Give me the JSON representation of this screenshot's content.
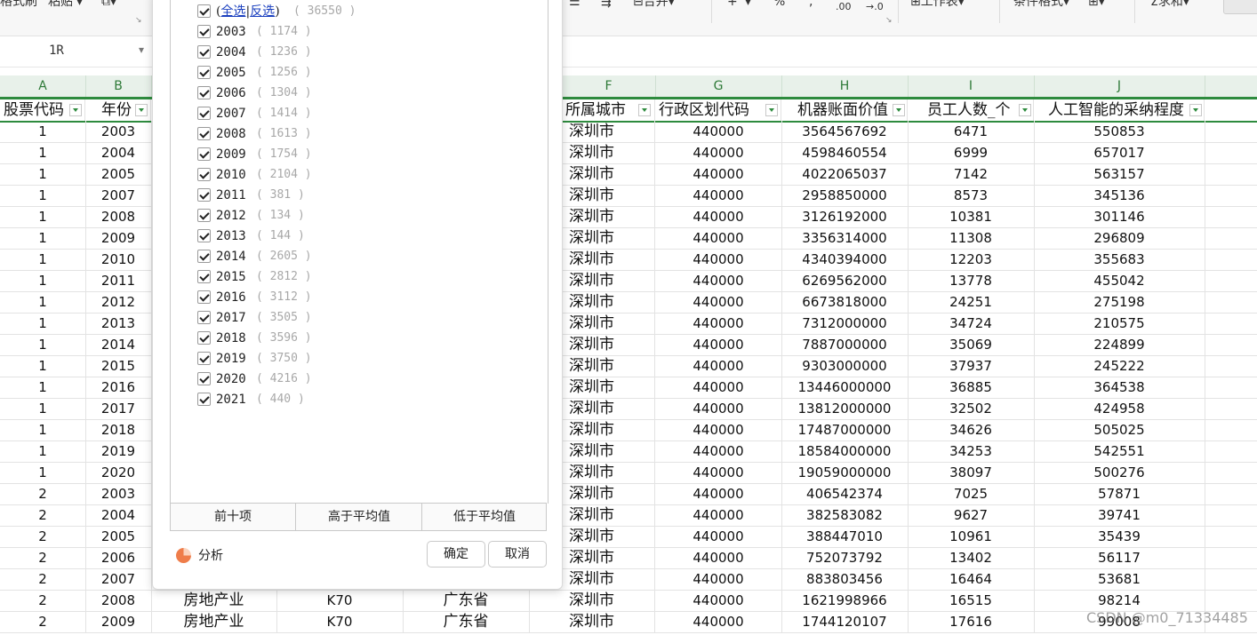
{
  "toolbar": {
    "items": [
      "格式刷",
      "粘贴",
      "合并",
      "工作表",
      "条件格式",
      "求和"
    ],
    "symbols": [
      "%",
      ",",
      ".00",
      "→.0",
      "+"
    ]
  },
  "formula_bar": {
    "name_box": "1R"
  },
  "columns": [
    "A",
    "B",
    "F",
    "G",
    "H",
    "I",
    "J"
  ],
  "headers": {
    "A": "股票代码",
    "B": "年份",
    "F": "所属城市",
    "G": "行政区划代码",
    "H": "机器账面价值",
    "I": "员工人数_个",
    "J": "人工智能的采纳程度"
  },
  "rows": [
    {
      "a": "1",
      "b": "2003",
      "f": "深圳市",
      "g": "440000",
      "h": "3564567692",
      "i": "6471",
      "j": "550853"
    },
    {
      "a": "1",
      "b": "2004",
      "f": "深圳市",
      "g": "440000",
      "h": "4598460554",
      "i": "6999",
      "j": "657017"
    },
    {
      "a": "1",
      "b": "2005",
      "f": "深圳市",
      "g": "440000",
      "h": "4022065037",
      "i": "7142",
      "j": "563157"
    },
    {
      "a": "1",
      "b": "2007",
      "f": "深圳市",
      "g": "440000",
      "h": "2958850000",
      "i": "8573",
      "j": "345136"
    },
    {
      "a": "1",
      "b": "2008",
      "f": "深圳市",
      "g": "440000",
      "h": "3126192000",
      "i": "10381",
      "j": "301146"
    },
    {
      "a": "1",
      "b": "2009",
      "f": "深圳市",
      "g": "440000",
      "h": "3356314000",
      "i": "11308",
      "j": "296809"
    },
    {
      "a": "1",
      "b": "2010",
      "f": "深圳市",
      "g": "440000",
      "h": "4340394000",
      "i": "12203",
      "j": "355683"
    },
    {
      "a": "1",
      "b": "2011",
      "f": "深圳市",
      "g": "440000",
      "h": "6269562000",
      "i": "13778",
      "j": "455042"
    },
    {
      "a": "1",
      "b": "2012",
      "f": "深圳市",
      "g": "440000",
      "h": "6673818000",
      "i": "24251",
      "j": "275198"
    },
    {
      "a": "1",
      "b": "2013",
      "f": "深圳市",
      "g": "440000",
      "h": "7312000000",
      "i": "34724",
      "j": "210575"
    },
    {
      "a": "1",
      "b": "2014",
      "f": "深圳市",
      "g": "440000",
      "h": "7887000000",
      "i": "35069",
      "j": "224899"
    },
    {
      "a": "1",
      "b": "2015",
      "f": "深圳市",
      "g": "440000",
      "h": "9303000000",
      "i": "37937",
      "j": "245222"
    },
    {
      "a": "1",
      "b": "2016",
      "f": "深圳市",
      "g": "440000",
      "h": "13446000000",
      "i": "36885",
      "j": "364538"
    },
    {
      "a": "1",
      "b": "2017",
      "f": "深圳市",
      "g": "440000",
      "h": "13812000000",
      "i": "32502",
      "j": "424958"
    },
    {
      "a": "1",
      "b": "2018",
      "f": "深圳市",
      "g": "440000",
      "h": "17487000000",
      "i": "34626",
      "j": "505025"
    },
    {
      "a": "1",
      "b": "2019",
      "f": "深圳市",
      "g": "440000",
      "h": "18584000000",
      "i": "34253",
      "j": "542551"
    },
    {
      "a": "1",
      "b": "2020",
      "f": "深圳市",
      "g": "440000",
      "h": "19059000000",
      "i": "38097",
      "j": "500276"
    },
    {
      "a": "2",
      "b": "2003",
      "f": "深圳市",
      "g": "440000",
      "h": "406542374",
      "i": "7025",
      "j": "57871"
    },
    {
      "a": "2",
      "b": "2004",
      "f": "深圳市",
      "g": "440000",
      "h": "382583082",
      "i": "9627",
      "j": "39741"
    },
    {
      "a": "2",
      "b": "2005",
      "f": "深圳市",
      "g": "440000",
      "h": "388447010",
      "i": "10961",
      "j": "35439"
    },
    {
      "a": "2",
      "b": "2006",
      "f": "深圳市",
      "g": "440000",
      "h": "752073792",
      "i": "13402",
      "j": "56117"
    },
    {
      "a": "2",
      "b": "2007",
      "f": "深圳市",
      "g": "440000",
      "h": "883803456",
      "i": "16464",
      "j": "53681"
    },
    {
      "a": "2",
      "b": "2008",
      "c": "房地产业",
      "d": "K70",
      "e": "广东省",
      "f": "深圳市",
      "g": "440000",
      "h": "1621998966",
      "i": "16515",
      "j": "98214"
    },
    {
      "a": "2",
      "b": "2009",
      "c": "房地产业",
      "d": "K70",
      "e": "广东省",
      "f": "深圳市",
      "g": "440000",
      "h": "1744120107",
      "i": "17616",
      "j": "99008"
    }
  ],
  "filter_popup": {
    "select_all": "全选",
    "invert": "反选",
    "total": "( 36550 )",
    "items": [
      {
        "label": "2003",
        "count": "( 1174 )"
      },
      {
        "label": "2004",
        "count": "( 1236 )"
      },
      {
        "label": "2005",
        "count": "( 1256 )"
      },
      {
        "label": "2006",
        "count": "( 1304 )"
      },
      {
        "label": "2007",
        "count": "( 1414 )"
      },
      {
        "label": "2008",
        "count": "( 1613 )"
      },
      {
        "label": "2009",
        "count": "( 1754 )"
      },
      {
        "label": "2010",
        "count": "( 2104 )"
      },
      {
        "label": "2011",
        "count": "( 381 )"
      },
      {
        "label": "2012",
        "count": "( 134 )"
      },
      {
        "label": "2013",
        "count": "( 144 )"
      },
      {
        "label": "2014",
        "count": "( 2605 )"
      },
      {
        "label": "2015",
        "count": "( 2812 )"
      },
      {
        "label": "2016",
        "count": "( 3112 )"
      },
      {
        "label": "2017",
        "count": "( 3505 )"
      },
      {
        "label": "2018",
        "count": "( 3596 )"
      },
      {
        "label": "2019",
        "count": "( 3750 )"
      },
      {
        "label": "2020",
        "count": "( 4216 )"
      },
      {
        "label": "2021",
        "count": "( 440 )"
      }
    ],
    "quick_buttons": [
      "前十项",
      "高于平均值",
      "低于平均值"
    ],
    "analyze": "分析",
    "ok": "确定",
    "cancel": "取消"
  },
  "watermark": "CSDN @m0_71334485"
}
